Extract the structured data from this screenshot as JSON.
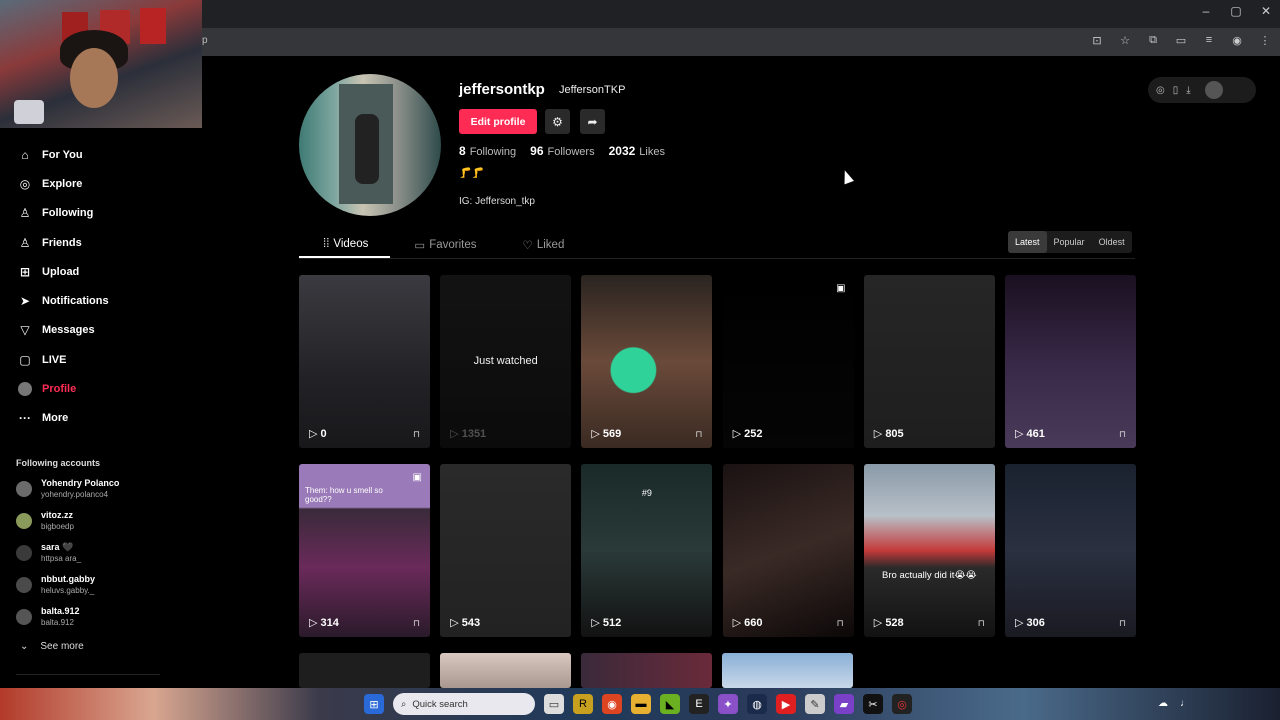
{
  "browser": {
    "url_fragment": "p",
    "window_controls": [
      "–",
      "▢",
      "✕"
    ],
    "toolbar_icons": [
      "install-icon",
      "star-icon",
      "extensions-icon",
      "sidebar-icon",
      "media-icon",
      "account-icon",
      "menu-icon"
    ]
  },
  "sidebar": {
    "items": [
      {
        "label": "For You",
        "icon": "home-icon"
      },
      {
        "label": "Explore",
        "icon": "compass-icon"
      },
      {
        "label": "Following",
        "icon": "user-icon"
      },
      {
        "label": "Friends",
        "icon": "users-icon"
      },
      {
        "label": "Upload",
        "icon": "plus-square-icon"
      },
      {
        "label": "Notifications",
        "icon": "send-icon"
      },
      {
        "label": "Messages",
        "icon": "filter-icon"
      },
      {
        "label": "LIVE",
        "icon": "live-icon"
      },
      {
        "label": "Profile",
        "icon": "avatar-icon",
        "active": true
      },
      {
        "label": "More",
        "icon": "more-icon"
      }
    ],
    "following_title": "Following accounts",
    "accounts": [
      {
        "name": "Yohendry Polanco",
        "handle": "yohendry.polanco4"
      },
      {
        "name": "vitoz.zz",
        "handle": "bigboedp"
      },
      {
        "name": "sara 🖤",
        "handle": "httpsa ara_"
      },
      {
        "name": "nbbut.gabby",
        "handle": "heluvs.gabby._"
      },
      {
        "name": "balta.912",
        "handle": "balta.912"
      }
    ],
    "see_more": "See more"
  },
  "profile": {
    "username": "jeffersontkp",
    "nickname": "JeffersonTKP",
    "edit_label": "Edit profile",
    "following_count": "8",
    "following_label": "Following",
    "followers_count": "96",
    "followers_label": "Followers",
    "likes_count": "2032",
    "likes_label": "Likes",
    "emoji_line": "🦵🦵",
    "bio": "IG: Jefferson_tkp"
  },
  "tabs": [
    {
      "label": "Videos",
      "icon": "grid-icon",
      "active": true
    },
    {
      "label": "Favorites",
      "icon": "bookmark-icon"
    },
    {
      "label": "Liked",
      "icon": "heart-icon"
    }
  ],
  "sort": [
    "Latest",
    "Popular",
    "Oldest"
  ],
  "videos": [
    {
      "views": "0",
      "locked": true,
      "bg": "linear-gradient(180deg,#3a3a40,#222226 60%,#18181a)"
    },
    {
      "views": "1351",
      "locked": false,
      "dim": true,
      "just": "Just watched",
      "bg": "linear-gradient(180deg,#141414,#0c0c0c)"
    },
    {
      "views": "569",
      "locked": true,
      "bg": "radial-gradient(circle at 40% 55%,#2fd39a 0 18%,transparent 19%),linear-gradient(180deg,#2a2420,#6a4a3a 50%,#3a2a22)"
    },
    {
      "views": "252",
      "locked": false,
      "corner": "🖼",
      "bg": "linear-gradient(180deg,#000,#050505)"
    },
    {
      "views": "805",
      "locked": false,
      "bg": "linear-gradient(180deg,#262626,#1e1e1e)"
    },
    {
      "views": "461",
      "locked": true,
      "bg": "linear-gradient(180deg,#1a1020,#3a2a4a 55%,#4a3a5a)"
    },
    {
      "views": "314",
      "locked": true,
      "caption": "Them: how u smell so good??",
      "corner": "🖼",
      "bg": "linear-gradient(180deg,#9a7ab8 0,#9a7ab8 25%,#3a2a3a 26%,#6a2a5a 60%,#2a1a2a)"
    },
    {
      "views": "543",
      "locked": false,
      "bg": "linear-gradient(180deg,#2a2a2a,#222)"
    },
    {
      "views": "512",
      "locked": false,
      "caption": "#9",
      "bg": "linear-gradient(180deg,#1a2a28,#2a3a38 50%,#121212)"
    },
    {
      "views": "660",
      "locked": true,
      "bg": "linear-gradient(160deg,#1a1212,#3a2a26 50%,#0c0808)"
    },
    {
      "views": "528",
      "locked": true,
      "caption": "Bro actually did it😭😭",
      "bg": "linear-gradient(180deg,#8a9aa8 0,#b8c0c8 30%,#c43a3a 50%,#2a2a2a 60%,#121212)"
    },
    {
      "views": "306",
      "locked": true,
      "bg": "linear-gradient(180deg,#1a2230,#2a3040 50%,#1a1a22)"
    }
  ],
  "taskbar": {
    "search_placeholder": "Quick search",
    "apps": [
      "chrome-icon",
      "folder-icon",
      "nvidia-icon",
      "epic-icon",
      "chat-icon",
      "steam-icon",
      "youtube-icon",
      "notes-icon",
      "app-icon",
      "capcut-icon",
      "game-icon"
    ]
  }
}
